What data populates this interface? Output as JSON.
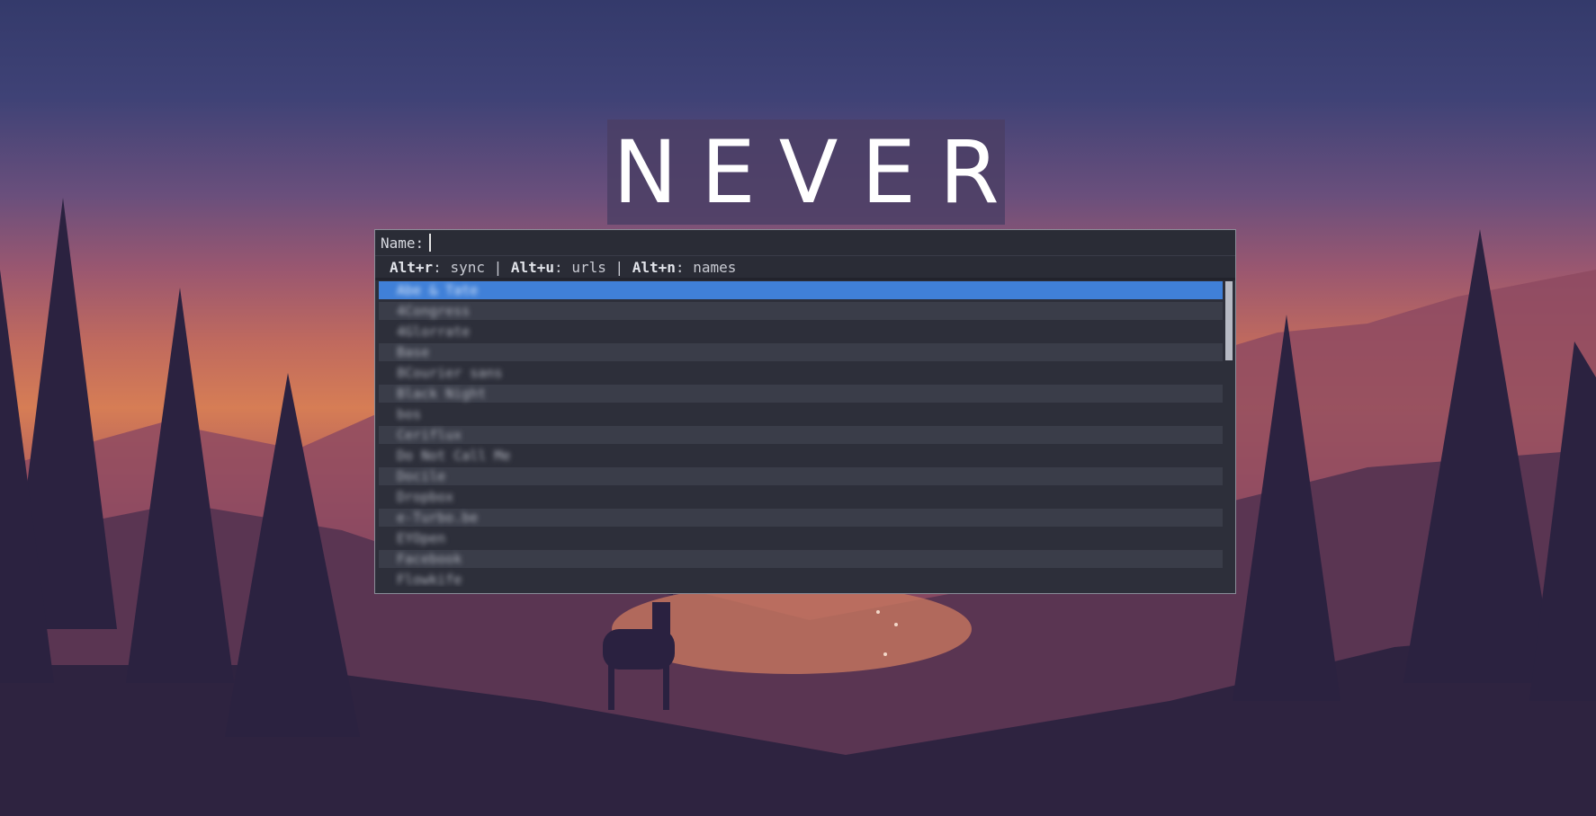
{
  "banner": {
    "text": "NEVER"
  },
  "prompt": {
    "label": "Name:"
  },
  "message": {
    "key_sync": "Alt+r",
    "label_sync": ": sync | ",
    "key_urls": "Alt+u",
    "label_urls": ": urls | ",
    "key_names": "Alt+n",
    "label_names": ": names"
  },
  "list": {
    "selected_index": 0,
    "items": [
      "Abe & Tate",
      "4Congress",
      "4Glorrate",
      "Base",
      "8Courier sans",
      "Black Night",
      "bos",
      "Ceriflux",
      "Do Not Call Me",
      "Docile",
      "Dropbox",
      "e-Turbo.be",
      "EYOpen",
      "Facebook",
      "Flowkife"
    ]
  },
  "scrollbar": {
    "position_fraction": 0.0,
    "visible_fraction": 0.26
  },
  "colors": {
    "selected": "#4080d8",
    "list_bg": "#2d2f3a",
    "row_alt": "#3a3d49",
    "border": "#8a8d98"
  }
}
